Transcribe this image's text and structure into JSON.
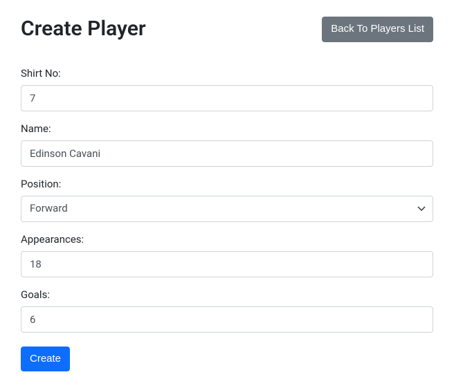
{
  "header": {
    "title": "Create Player",
    "back_button": "Back To Players List"
  },
  "form": {
    "shirt_no": {
      "label": "Shirt No:",
      "value": "7"
    },
    "name": {
      "label": "Name:",
      "value": "Edinson Cavani"
    },
    "position": {
      "label": "Position:",
      "value": "Forward",
      "options": [
        "Forward"
      ]
    },
    "appearances": {
      "label": "Appearances:",
      "value": "18"
    },
    "goals": {
      "label": "Goals:",
      "value": "6"
    },
    "submit_label": "Create"
  }
}
